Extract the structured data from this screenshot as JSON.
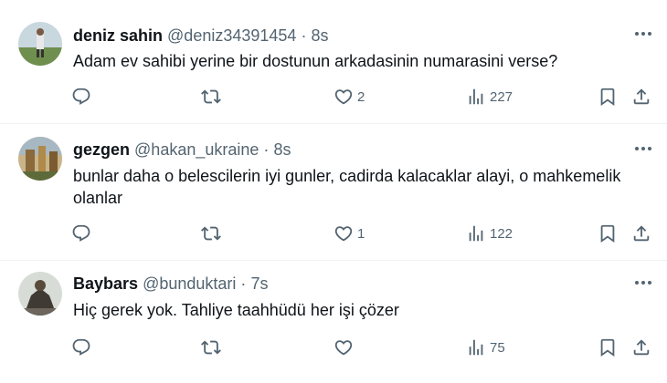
{
  "tweets": [
    {
      "name": "deniz sahin",
      "handle": "@deniz34391454",
      "separator": "·",
      "time": "8s",
      "text": "Adam ev sahibi yerine bir dostunun arkadasinin numarasini verse?",
      "likes": "2",
      "views": "227"
    },
    {
      "name": "gezgen",
      "handle": "@hakan_ukraine",
      "separator": "·",
      "time": "8s",
      "text": "bunlar daha o belescilerin iyi gunler, cadirda kalacaklar alayi, o mahkemelik olanlar",
      "likes": "1",
      "views": "122"
    },
    {
      "name": "Baybars",
      "handle": "@bunduktari",
      "separator": "·",
      "time": "7s",
      "text": "Hiç gerek yok. Tahliye taahhüdü her işi çözer",
      "likes": "",
      "views": "75"
    }
  ],
  "icons": {
    "more": "more-horizontal-icon",
    "reply": "reply-icon",
    "retweet": "retweet-icon",
    "like": "heart-icon",
    "views": "views-chart-icon",
    "bookmark": "bookmark-icon",
    "share": "share-icon"
  },
  "colors": {
    "text": "#0f1419",
    "secondary": "#536471",
    "divider": "#eff3f4"
  }
}
